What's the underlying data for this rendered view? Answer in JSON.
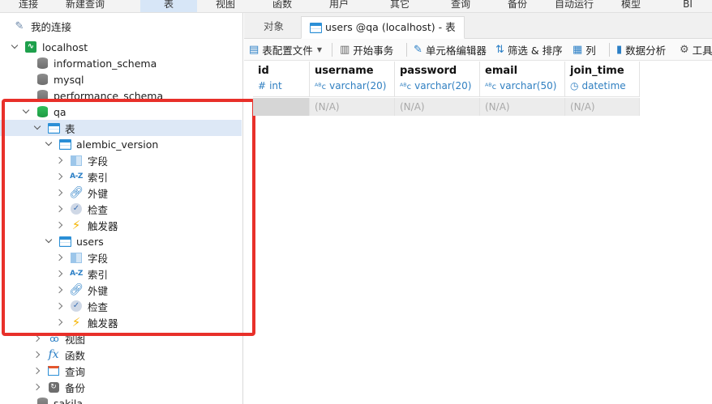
{
  "menubar": {
    "items": [
      "连接",
      "新建查询",
      "表",
      "视图",
      "函数",
      "用户",
      "其它",
      "查询",
      "备份",
      "自动运行",
      "模型",
      "BI"
    ]
  },
  "navigator": {
    "my_connections": "我的连接",
    "connection": "localhost",
    "databases": {
      "information_schema": "information_schema",
      "mysql": "mysql",
      "performance_schema": "performance_schema",
      "qa": "qa",
      "sakila": "sakila"
    },
    "tables_group": "表",
    "tables": [
      {
        "name": "alembic_version",
        "children": [
          "字段",
          "索引",
          "外键",
          "检查",
          "触发器"
        ]
      },
      {
        "name": "users",
        "children": [
          "字段",
          "索引",
          "外键",
          "检查",
          "触发器"
        ]
      }
    ],
    "other_groups": [
      "视图",
      "函数",
      "查询",
      "备份"
    ]
  },
  "tabs": {
    "objects": "对象",
    "active": "users @qa (localhost) - 表"
  },
  "toolbar": {
    "table_config": "表配置文件",
    "begin_tx": "开始事务",
    "cell_editor": "单元格编辑器",
    "filter_sort": "筛选 & 排序",
    "columns": "列",
    "data_analysis": "数据分析",
    "tools": "工具"
  },
  "grid": {
    "columns": [
      {
        "name": "id",
        "type": "int",
        "type_symbol": "#"
      },
      {
        "name": "username",
        "type": "varchar(20)",
        "type_symbol": "ABC"
      },
      {
        "name": "password",
        "type": "varchar(20)",
        "type_symbol": "ABC"
      },
      {
        "name": "email",
        "type": "varchar(50)",
        "type_symbol": "ABC"
      },
      {
        "name": "join_time",
        "type": "datetime",
        "type_symbol": "clock"
      }
    ],
    "null_value": "(N/A)"
  },
  "colors": {
    "highlight": "#e8302a",
    "selected_row": "#dde8f6",
    "type_text": "#2f7fc1"
  }
}
